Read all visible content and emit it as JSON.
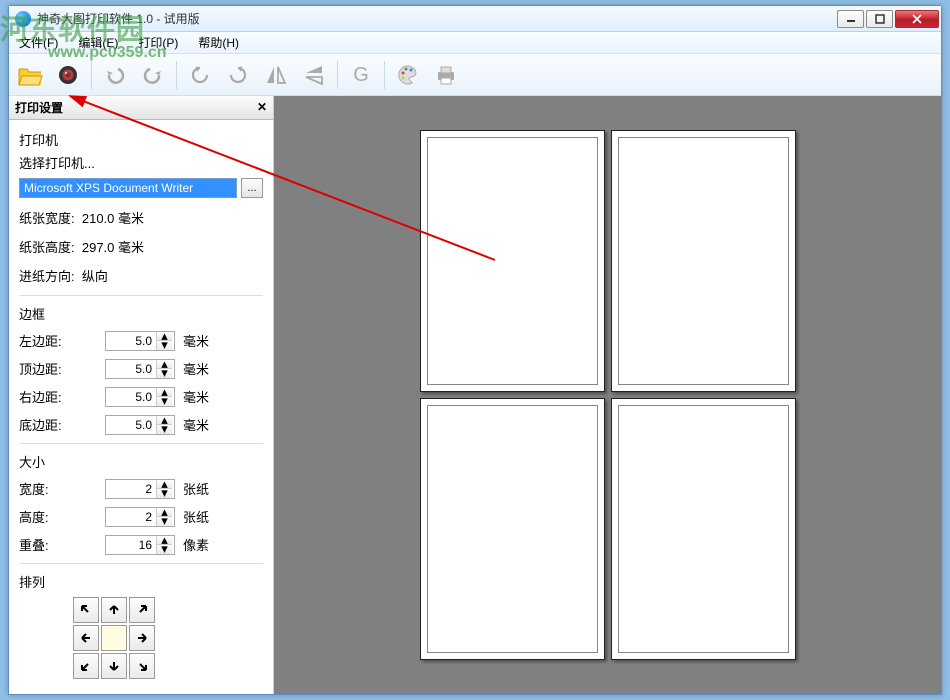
{
  "window": {
    "title": "神奇大图打印软件 1.0 - 试用版"
  },
  "watermark": {
    "text": "河东软件园",
    "url": "www.pc0359.cn"
  },
  "menubar": {
    "file": "文件(F)",
    "edit": "编辑(E)",
    "print": "打印(P)",
    "help": "帮助(H)"
  },
  "sidebar": {
    "title": "打印设置",
    "close_x": "✕",
    "printer": {
      "section": "打印机",
      "select_label": "选择打印机...",
      "selected": "Microsoft XPS Document Writer",
      "browse": "..."
    },
    "paper": {
      "width_label": "纸张宽度:",
      "width_value": "210.0 毫米",
      "height_label": "纸张高度:",
      "height_value": "297.0 毫米",
      "orient_label": "进纸方向:",
      "orient_value": "纵向"
    },
    "margins": {
      "section": "边框",
      "left_label": "左边距:",
      "top_label": "顶边距:",
      "right_label": "右边距:",
      "bottom_label": "底边距:",
      "value": "5.0",
      "unit": "毫米"
    },
    "size": {
      "section": "大小",
      "width_label": "宽度:",
      "height_label": "高度:",
      "sheets_value": "2",
      "sheets_unit": "张纸",
      "overlap_label": "重叠:",
      "overlap_value": "16",
      "overlap_unit": "像素"
    },
    "arrange": {
      "section": "排列"
    }
  }
}
